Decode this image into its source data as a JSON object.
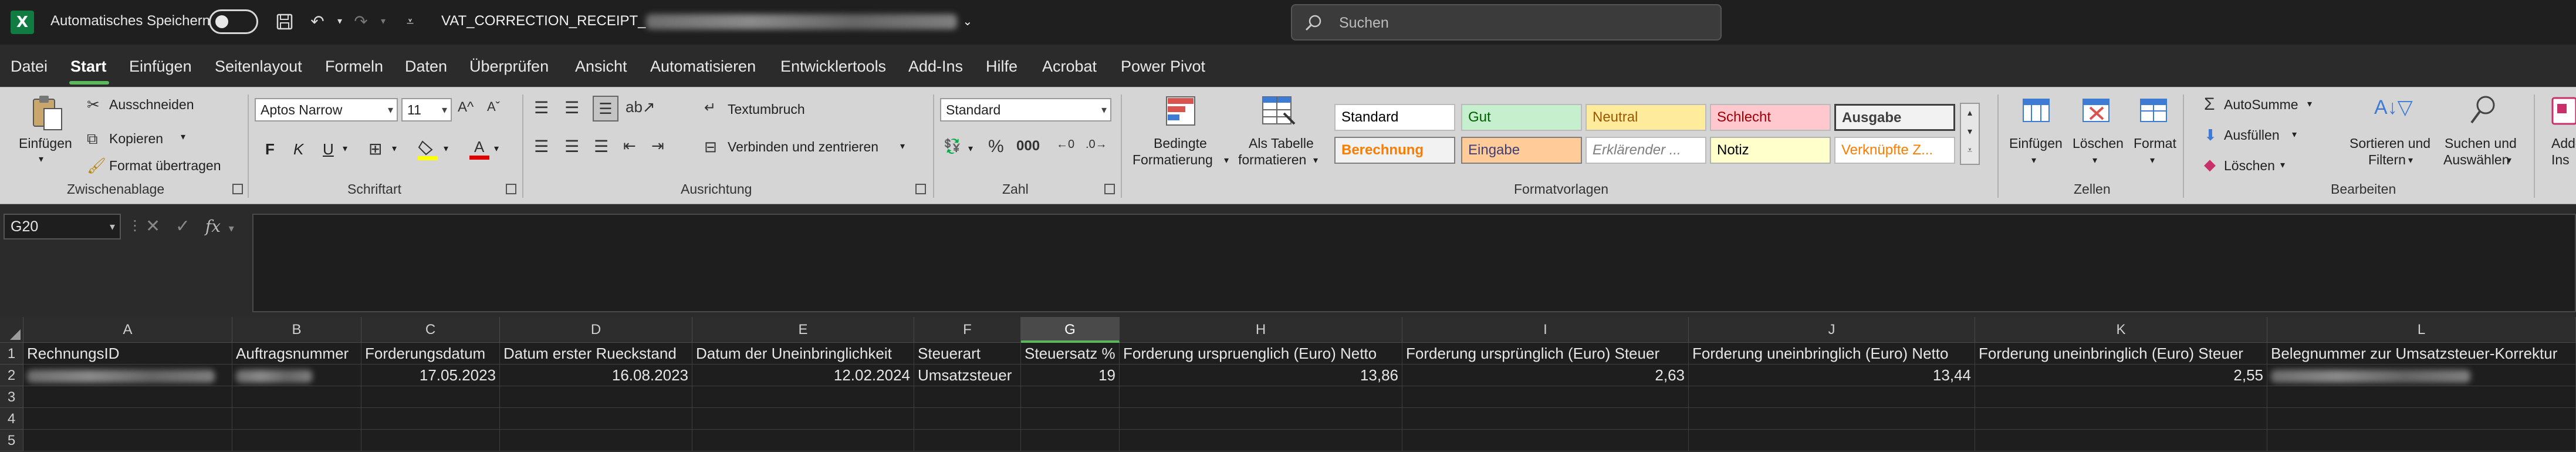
{
  "title_bar": {
    "app_logo": "X",
    "autosave_label": "Automatisches Speichern",
    "autosave_state": "off",
    "filename": "VAT_CORRECTION_RECEIPT_",
    "search_placeholder": "Suchen"
  },
  "menu": {
    "tabs": [
      "Datei",
      "Start",
      "Einfügen",
      "Seitenlayout",
      "Formeln",
      "Daten",
      "Überprüfen",
      "Ansicht",
      "Automatisieren",
      "Entwicklertools",
      "Add-Ins",
      "Hilfe",
      "Acrobat",
      "Power Pivot"
    ],
    "active_tab": "Start"
  },
  "ribbon": {
    "clipboard": {
      "paste": "Einfügen",
      "cut": "Ausschneiden",
      "copy": "Kopieren",
      "format_painter": "Format übertragen",
      "label": "Zwischenablage"
    },
    "font": {
      "family": "Aptos Narrow",
      "size": "11",
      "bold": "F",
      "italic": "K",
      "underline": "U",
      "label": "Schriftart"
    },
    "alignment": {
      "wrap": "Textumbruch",
      "merge": "Verbinden und zentrieren",
      "label": "Ausrichtung"
    },
    "number": {
      "format": "Standard",
      "label": "Zahl"
    },
    "styles": {
      "conditional": [
        "Bedingte",
        "Formatierung"
      ],
      "as_table": [
        "Als Tabelle",
        "formatieren"
      ],
      "cells": [
        "Standard",
        "Gut",
        "Neutral",
        "Schlecht",
        "Ausgabe",
        "Berechnung",
        "Eingabe",
        "Erklärender ...",
        "Notiz",
        "Verknüpfte Z..."
      ],
      "label": "Formatvorlagen"
    },
    "cells": {
      "insert": "Einfügen",
      "delete": "Löschen",
      "format": "Format",
      "label": "Zellen"
    },
    "editing": {
      "autosum": "AutoSumme",
      "fill": "Ausfüllen",
      "clear": "Löschen",
      "sort": [
        "Sortieren und",
        "Filtern"
      ],
      "find": [
        "Suchen und",
        "Auswählen"
      ],
      "label": "Bearbeiten"
    },
    "addins": [
      "Add-",
      "Ins"
    ]
  },
  "formula_bar": {
    "name_box": "G20",
    "fx": "fx",
    "content": ""
  },
  "sheet": {
    "selected_column": "G",
    "columns": [
      "A",
      "B",
      "C",
      "D",
      "E",
      "F",
      "G",
      "H",
      "I",
      "J",
      "K",
      "L"
    ],
    "rows": [
      "1",
      "2",
      "3",
      "4",
      "5"
    ],
    "header_row": [
      "RechnungsID",
      "Auftragsnummer",
      "Forderungsdatum",
      "Datum erster Rueckstand",
      "Datum der Uneinbringlichkeit",
      "Steuerart",
      "Steuersatz %",
      "Forderung urspruenglich (Euro) Netto",
      "Forderung ursprünglich (Euro) Steuer",
      "Forderung uneinbringlich (Euro) Netto",
      "Forderung uneinbringlich (Euro) Steuer",
      "Belegnummer zur Umsatzsteuer-Korrektur"
    ],
    "data_row": [
      "",
      "",
      "17.05.2023",
      "16.08.2023",
      "12.02.2024",
      "Umsatzsteuer",
      "19",
      "13,86",
      "2,63",
      "13,44",
      "2,55",
      ""
    ]
  }
}
